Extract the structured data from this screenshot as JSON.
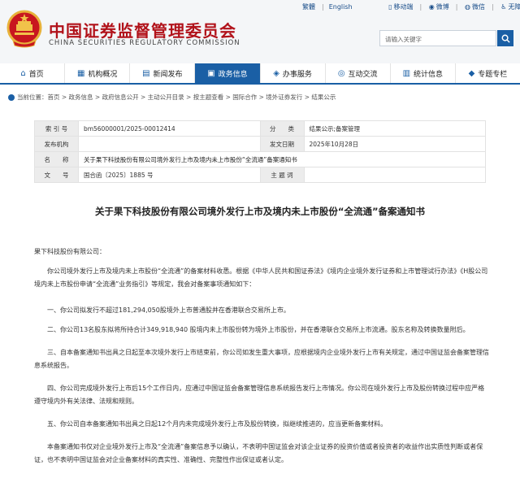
{
  "header": {
    "title_cn": "中国证券监督管理委员会",
    "title_en": "CHINA SECURITIES REGULATORY COMMISSION",
    "top_links": {
      "traditional": "繁體",
      "english": "English",
      "mobile": "移动端",
      "weibo": "微博",
      "wechat": "微信",
      "accessibility": "无障碍"
    },
    "search_placeholder": "请输入关键字"
  },
  "nav": [
    {
      "label": "首页",
      "icon": "home-icon"
    },
    {
      "label": "机构概况",
      "icon": "institution-icon"
    },
    {
      "label": "新闻发布",
      "icon": "news-icon"
    },
    {
      "label": "政务信息",
      "icon": "government-icon"
    },
    {
      "label": "办事服务",
      "icon": "service-icon"
    },
    {
      "label": "互动交流",
      "icon": "interaction-icon"
    },
    {
      "label": "统计信息",
      "icon": "statistics-icon"
    },
    {
      "label": "专题专栏",
      "icon": "topics-icon"
    }
  ],
  "active_nav": 3,
  "breadcrumb": "当前位置：首页 > 政务信息 > 政府信息公开 > 主动公开目录 > 按主题查看 > 国际合作 > 境外证券发行 > 结果公示",
  "info": {
    "index_label": "索 引 号",
    "index_value": "bm56000001/2025-00012414",
    "category_label": "分　　类",
    "category_value": "结果公示;备案管理",
    "publisher_label": "发布机构",
    "publisher_value": "",
    "date_label": "发文日期",
    "date_value": "2025年10月28日",
    "name_label": "名　　称",
    "name_value": "关于果下科技股份有限公司境外发行上市及境内未上市股份“全流通”备案通知书",
    "docno_label": "文　　号",
    "docno_value": "国合函〔2025〕1885 号",
    "keyword_label": "主 题 词",
    "keyword_value": ""
  },
  "doc": {
    "title": "关于果下科技股份有限公司境外发行上市及境内未上市股份“全流通”备案通知书",
    "salutation": "果下科技股份有限公司：",
    "p1": "你公司境外发行上市及境内未上市股份“全流通”的备案材料收悉。根据《中华人民共和国证券法》《境内企业境外发行证券和上市管理试行办法》《H股公司境内未上市股份申请“全流通”业务指引》等规定，我会对备案事项通知如下：",
    "p2": "一、你公司拟发行不超过181,294,050股境外上市普通股并在香港联合交易所上市。",
    "p3": "二、你公司13名股东拟将所持合计349,918,940 股境内未上市股份转为境外上市股份，并在香港联合交易所上市流通。股东名称及转换数量附后。",
    "p4": "三、自本备案通知书出具之日起至本次境外发行上市结束前，你公司如发生重大事项，应根据境内企业境外发行上市有关规定，通过中国证监会备案管理信息系统报告。",
    "p5": "四、你公司完成境外发行上市后15个工作日内，应通过中国证监会备案管理信息系统报告发行上市情况。你公司在境外发行上市及股份转换过程中应严格遵守境内外有关法律、法规和规则。",
    "p6": "五、你公司自本备案通知书出具之日起12个月内未完成境外发行上市及股份转换，拟继续推进的，应当更新备案材料。",
    "p7": "本备案通知书仅对企业境外发行上市及“全流通”备案信息予以确认，不表明中国证监会对该企业证券的投资价值或者投资者的收益作出实质性判断或者保证，也不表明中国证监会对企业备案材料的真实性、准确性、完整性作出保证或者认定。"
  },
  "colors": {
    "brand_red": "#b1121a",
    "nav_blue": "#1a5fa5",
    "header_bg": "#f4f6f8"
  }
}
